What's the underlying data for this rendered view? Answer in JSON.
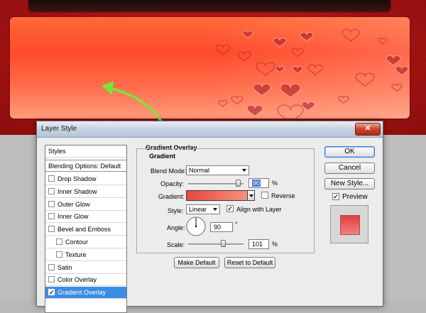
{
  "dialog": {
    "title": "Layer Style",
    "close_symbol": "✕"
  },
  "styles_list": {
    "header": "Styles",
    "blending_options": "Blending Options: Default",
    "items": [
      {
        "label": "Drop Shadow",
        "checked": false,
        "indent": false
      },
      {
        "label": "Inner Shadow",
        "checked": false,
        "indent": false
      },
      {
        "label": "Outer Glow",
        "checked": false,
        "indent": false
      },
      {
        "label": "Inner Glow",
        "checked": false,
        "indent": false
      },
      {
        "label": "Bevel and Emboss",
        "checked": false,
        "indent": false
      },
      {
        "label": "Contour",
        "checked": false,
        "indent": true
      },
      {
        "label": "Texture",
        "checked": false,
        "indent": true
      },
      {
        "label": "Satin",
        "checked": false,
        "indent": false
      },
      {
        "label": "Color Overlay",
        "checked": false,
        "indent": false
      },
      {
        "label": "Gradient Overlay",
        "checked": true,
        "indent": false,
        "selected": true
      }
    ]
  },
  "panel": {
    "section_title": "Gradient Overlay",
    "group_title": "Gradient",
    "blend_mode_label": "Blend Mode:",
    "blend_mode_value": "Normal",
    "opacity_label": "Opacity:",
    "opacity_value": "90",
    "opacity_unit": "%",
    "opacity_fraction": 0.9,
    "gradient_label": "Gradient:",
    "gradient_colors": [
      "#e9473c",
      "#f79a86"
    ],
    "reverse_label": "Reverse",
    "reverse_checked": false,
    "style_label": "Style:",
    "style_value": "Linear",
    "align_label": "Align with Layer",
    "align_checked": true,
    "angle_label": "Angle:",
    "angle_value": "90",
    "angle_unit": "°",
    "scale_label": "Scale:",
    "scale_value": "101",
    "scale_unit": "%",
    "make_default": "Make Default",
    "reset_default": "Reset to Default"
  },
  "actions": {
    "ok": "OK",
    "cancel": "Cancel",
    "new_style": "New Style...",
    "preview_label": "Preview",
    "preview_checked": true,
    "preview_colors": [
      "#e23f3f",
      "#f08080"
    ]
  },
  "colors": {
    "banner_top": "#ff6a3a",
    "banner_bottom": "#ff9b7b",
    "arrow": "#7fe23a",
    "selection": "#3b8de4"
  }
}
